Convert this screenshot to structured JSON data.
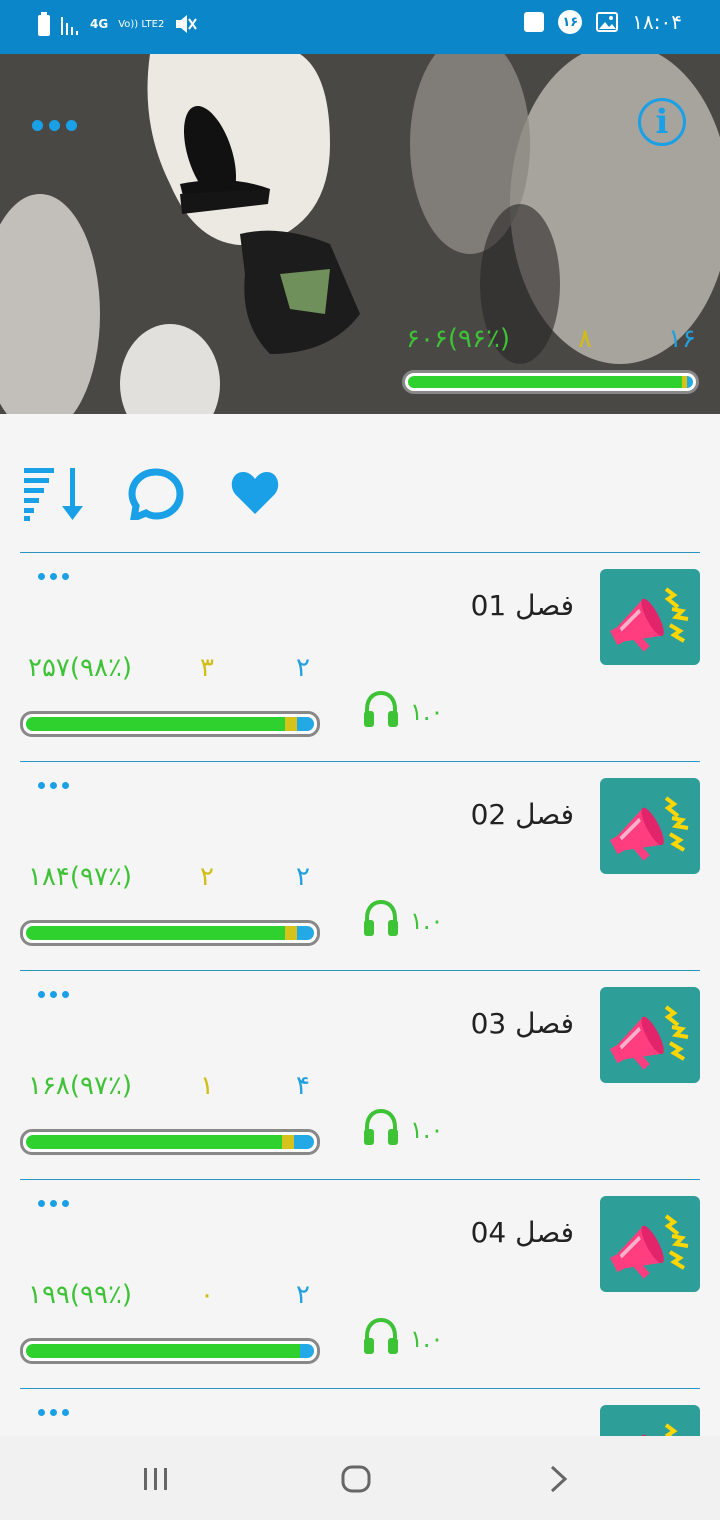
{
  "status_bar": {
    "time": "۱۸:۰۴",
    "notification_count": "۱۶",
    "network": "4G",
    "lte": "Vo)) LTE2"
  },
  "header": {
    "more_icon": "more-dots-icon",
    "info_icon": "info-icon",
    "stats": {
      "left": "۶۰۶(۹۶٪)",
      "middle": "۸",
      "right": "۱۶"
    },
    "progress": {
      "green": 0.96,
      "yellow": 0.02,
      "blue": 0.02
    }
  },
  "toolbar": {
    "icons": [
      "sort-icon",
      "comment-icon",
      "heart-icon"
    ]
  },
  "chapters": [
    {
      "title": "فصل 01",
      "stat_left": "۲۵۷(۹۸٪)",
      "stat_mid": "۳",
      "stat_right": "۲",
      "speed": "۱.۰",
      "progress": {
        "green": 0.9,
        "yellow": 0.04,
        "blue": 0.06
      }
    },
    {
      "title": "فصل 02",
      "stat_left": "۱۸۴(۹۷٪)",
      "stat_mid": "۲",
      "stat_right": "۲",
      "speed": "۱.۰",
      "progress": {
        "green": 0.9,
        "yellow": 0.04,
        "blue": 0.06
      }
    },
    {
      "title": "فصل 03",
      "stat_left": "۱۶۸(۹۷٪)",
      "stat_mid": "۱",
      "stat_right": "۴",
      "speed": "۱.۰",
      "progress": {
        "green": 0.89,
        "yellow": 0.04,
        "blue": 0.07
      }
    },
    {
      "title": "فصل 04",
      "stat_left": "۱۹۹(۹۹٪)",
      "stat_mid": "۰",
      "stat_right": "۲",
      "speed": "۱.۰",
      "progress": {
        "green": 0.95,
        "yellow": 0.0,
        "blue": 0.05
      }
    }
  ],
  "colors": {
    "primary": "#0a86c9",
    "accent": "#1aa0e6",
    "green": "#3ec236",
    "yellow": "#d1bd14",
    "blue": "#22a0dd",
    "thumb_bg": "#2e9e99"
  },
  "nav": {
    "icons": [
      "recent-apps-icon",
      "home-icon",
      "back-icon"
    ]
  }
}
